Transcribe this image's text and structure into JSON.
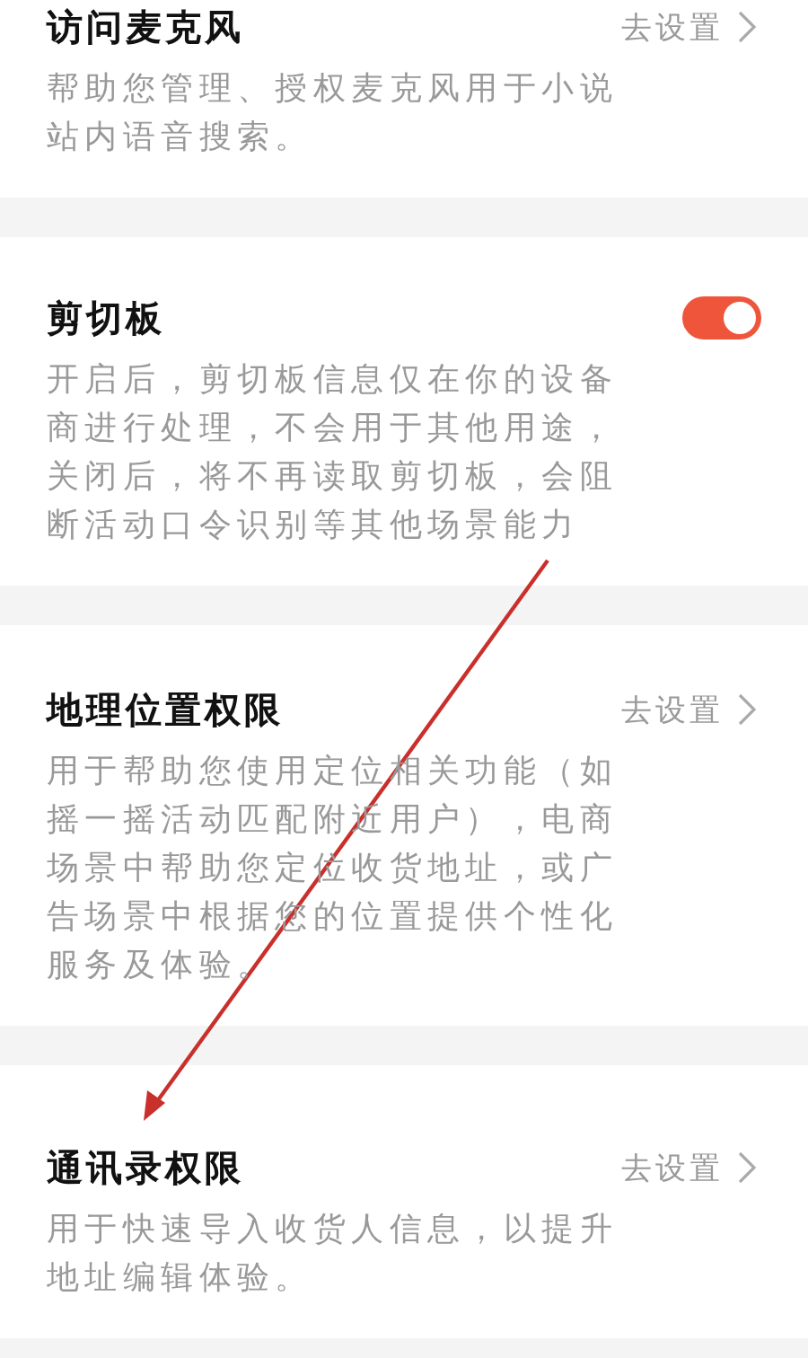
{
  "items": [
    {
      "kind": "link",
      "title": "访问麦克风",
      "action": "去设置",
      "description": "帮助您管理、授权麦克风用于小说站内语音搜索。"
    },
    {
      "kind": "toggle",
      "title": "剪切板",
      "on": true,
      "description": "开启后，剪切板信息仅在你的设备商进行处理，不会用于其他用途，关闭后，将不再读取剪切板，会阻断活动口令识别等其他场景能力"
    },
    {
      "kind": "link",
      "title": "地理位置权限",
      "action": "去设置",
      "description": "用于帮助您使用定位相关功能（如摇一摇活动匹配附近用户），电商场景中帮助您定位收货地址，或广告场景中根据您的位置提供个性化服务及体验。"
    },
    {
      "kind": "link",
      "title": "通讯录权限",
      "action": "去设置",
      "description": "用于快速导入收货人信息，以提升地址编辑体验。"
    }
  ]
}
